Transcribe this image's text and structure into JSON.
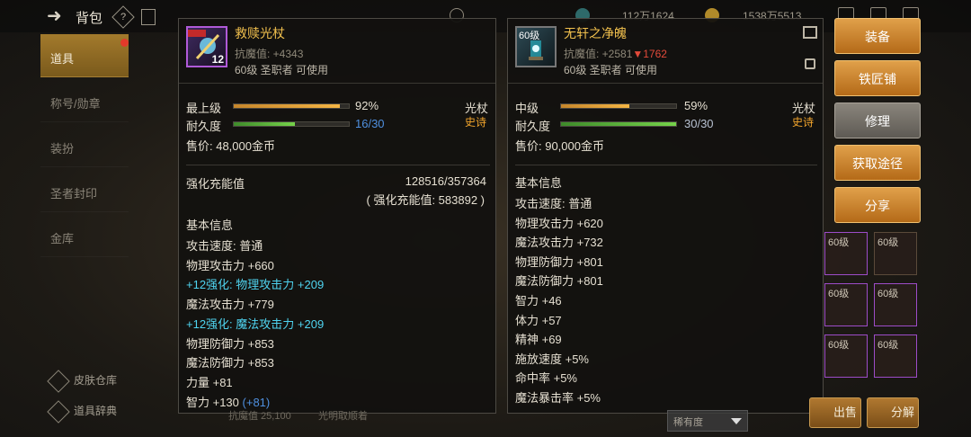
{
  "header": {
    "title": "背包",
    "help_icon_text": "?",
    "resource1": "112万1624",
    "resource2": "1538万5513"
  },
  "sidebar": {
    "items": [
      {
        "label": "道具",
        "active": true
      },
      {
        "label": "称号/勋章"
      },
      {
        "label": "装扮"
      },
      {
        "label": "圣者封印"
      },
      {
        "label": "金库"
      }
    ],
    "bottom": [
      {
        "label": "皮肤仓库"
      },
      {
        "label": "道具辞典"
      }
    ]
  },
  "left_item": {
    "name": "救赎光杖",
    "thumb_level": "12",
    "resist": "抗魔值: +4343",
    "req": "60级 圣职者 可使用",
    "grade_label": "最上级",
    "grade_pct": "92%",
    "grade_value": 0.92,
    "durability_label": "耐久度",
    "durability": "16/30",
    "durability_value": 0.533,
    "type": "光杖",
    "rarity": "史诗",
    "price": "售价: 48,000金币",
    "amp_label": "强化充能值",
    "amp_value": "128516/357364",
    "amp_note": "( 强化充能值: 583892 )",
    "basic_title": "基本信息",
    "stats": [
      {
        "text": "攻击速度:  普通",
        "cls": ""
      },
      {
        "text": "物理攻击力 +660",
        "cls": ""
      },
      {
        "text": "+12强化:  物理攻击力 +209",
        "cls": "cyan"
      },
      {
        "text": "魔法攻击力 +779",
        "cls": ""
      },
      {
        "text": "+12强化:  魔法攻击力 +209",
        "cls": "cyan"
      },
      {
        "text": "物理防御力 +853",
        "cls": ""
      },
      {
        "text": "魔法防御力 +853",
        "cls": ""
      },
      {
        "text": "力量 +81",
        "cls": ""
      }
    ],
    "last_stat": "智力 +130",
    "last_stat_bonus": "(+81)"
  },
  "right_item": {
    "name": "无轩之净魄",
    "thumb_level": "60级",
    "resist": "抗魔值: +2581",
    "resist_diff": "▼1762",
    "req": "60级 圣职者 可使用",
    "grade_label": "中级",
    "grade_pct": "59%",
    "grade_value": 0.59,
    "durability_label": "耐久度",
    "durability": "30/30",
    "durability_value": 1.0,
    "type": "光杖",
    "rarity": "史诗",
    "price": "售价: 90,000金币",
    "basic_title": "基本信息",
    "stats": [
      "攻击速度:  普通",
      "物理攻击力 +620",
      "魔法攻击力 +732",
      "物理防御力 +801",
      "魔法防御力 +801",
      "智力 +46",
      "体力 +57",
      "精神 +69",
      "施放速度 +5%",
      "命中率 +5%",
      "魔法暴击率 +5%"
    ]
  },
  "actions": {
    "equip": "装备",
    "blacksmith": "铁匠铺",
    "repair": "修理",
    "obtain": "获取途径",
    "share": "分享"
  },
  "slots": [
    "60级",
    "60级",
    "60级",
    "60级",
    "60级",
    "60级"
  ],
  "bottom": {
    "sell": "出售",
    "disassemble": "分解",
    "filter": "稀有度",
    "behind_text": "抗魔值 25,100",
    "behind_text2": "光明取顺着"
  }
}
